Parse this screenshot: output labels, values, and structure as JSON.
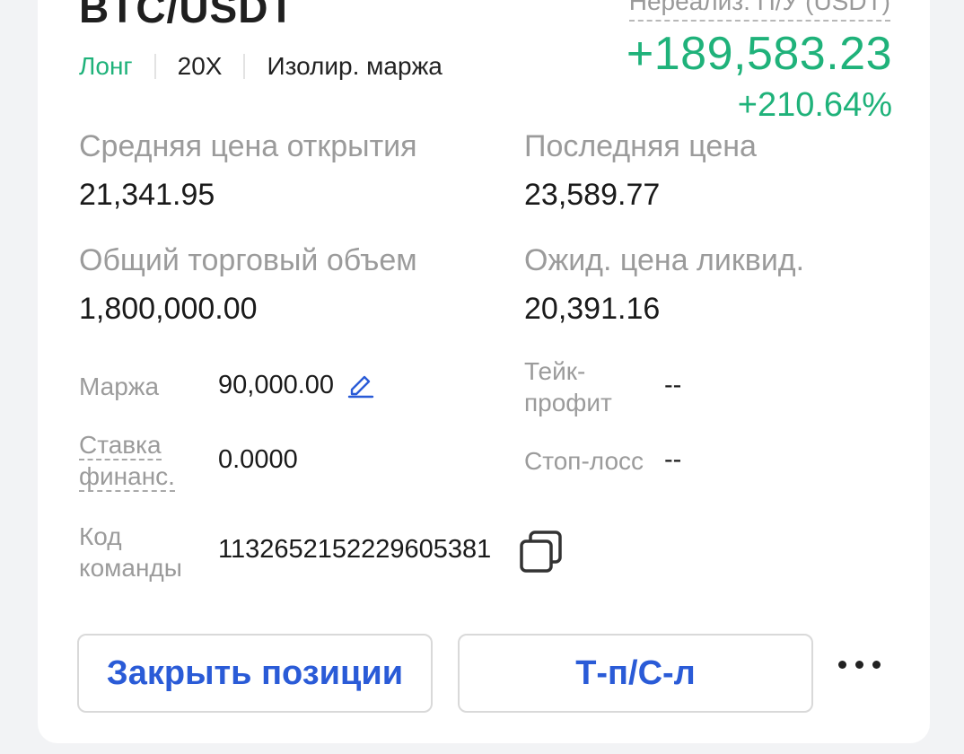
{
  "position": {
    "symbol": "BTC/USDT",
    "side": "Лонг",
    "leverage": "20X",
    "margin_mode": "Изолир. маржа"
  },
  "pnl": {
    "label": "Нереализ. П/У (USDT)",
    "value": "+189,583.23",
    "percent": "+210.64%"
  },
  "stats": {
    "avg_open_label": "Средняя цена открытия",
    "avg_open_value": "21,341.95",
    "last_price_label": "Последняя цена",
    "last_price_value": "23,589.77",
    "volume_label": "Общий торговый объем",
    "volume_value": "1,800,000.00",
    "liq_label": "Ожид. цена ликвид.",
    "liq_value": "20,391.16"
  },
  "details": {
    "margin_label": "Маржа",
    "margin_value": "90,000.00",
    "tp_label": "Тейк-профит",
    "tp_value": "--",
    "funding_label": "Ставка финанс.",
    "funding_value": "0.0000",
    "sl_label": "Стоп-лосс",
    "sl_value": "--",
    "order_id_label": "Код команды",
    "order_id_value": "1132652152229605381"
  },
  "actions": {
    "close_label": "Закрыть позиции",
    "tpsl_label": "Т-п/С-л"
  },
  "icons": {
    "edit": "pencil-icon",
    "copy": "copy-icon",
    "more": "more-dots-icon"
  },
  "colors": {
    "profit": "#1fb27a",
    "accent": "#2a5bd7",
    "label": "#9b9b9b"
  }
}
